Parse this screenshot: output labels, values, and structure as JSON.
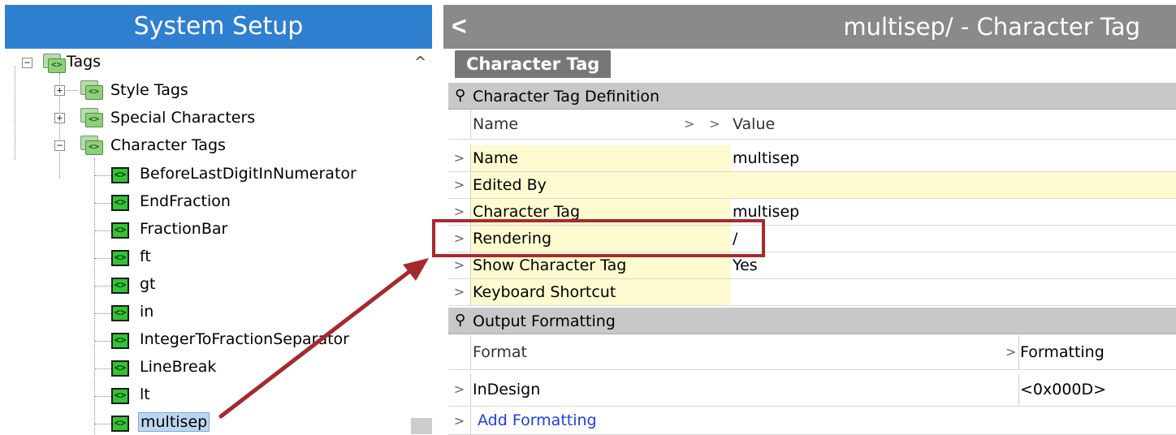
{
  "left_panel": {
    "title": "System Setup",
    "tree": {
      "root": "Tags",
      "children": [
        "Style Tags",
        "Special Characters",
        "Character Tags"
      ],
      "character_tags": [
        "BeforeLastDigitInNumerator",
        "EndFraction",
        "FractionBar",
        "ft",
        "gt",
        "in",
        "IntegerToFractionSeparator",
        "LineBreak",
        "lt",
        "multisep"
      ],
      "selected": "multisep"
    }
  },
  "right_panel": {
    "title": "multisep/ - Character Tag",
    "tab_label": "Character Tag",
    "section1": {
      "title": "Character Tag Definition",
      "col_name": "Name",
      "col_value": "Value",
      "rows": [
        {
          "name": "Name",
          "value": "multisep"
        },
        {
          "name": "Edited By",
          "value": ""
        },
        {
          "name": "Character Tag",
          "value": "multisep"
        },
        {
          "name": "Rendering",
          "value": "/"
        },
        {
          "name": "Show Character Tag",
          "value": "Yes"
        },
        {
          "name": "Keyboard Shortcut",
          "value": ""
        }
      ]
    },
    "section2": {
      "title": "Output Formatting",
      "col_format": "Format",
      "col_formatting": "Formatting",
      "rows": [
        {
          "format": "InDesign",
          "formatting": "<0x000D>"
        }
      ],
      "add_link": "Add Formatting"
    }
  },
  "colors": {
    "left_header": "#2f7fd1",
    "right_header": "#8a8a8a",
    "highlight": "#a52a30",
    "row_yellow": "#fffbd0"
  }
}
